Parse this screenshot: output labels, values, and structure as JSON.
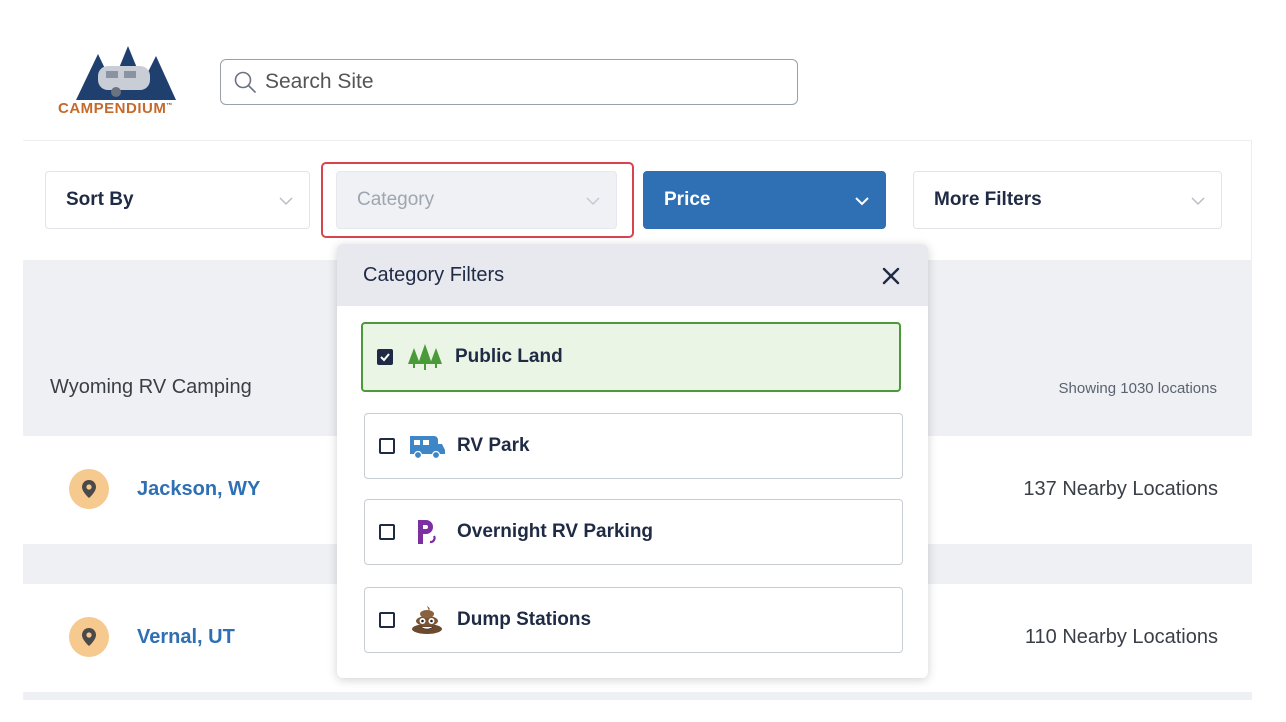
{
  "brand": {
    "logo_text": "CAMPENDIUM",
    "tm": "™"
  },
  "search": {
    "placeholder": "Search Site"
  },
  "filters": {
    "sort_label": "Sort By",
    "category_label": "Category",
    "price_label": "Price",
    "more_label": "More Filters"
  },
  "category_panel": {
    "title": "Category Filters",
    "options": [
      {
        "label": "Public Land",
        "checked": true,
        "icon": "trees-icon"
      },
      {
        "label": "RV Park",
        "checked": false,
        "icon": "rv-icon"
      },
      {
        "label": "Overnight RV Parking",
        "checked": false,
        "icon": "overnight-parking-icon"
      },
      {
        "label": "Dump Stations",
        "checked": false,
        "icon": "dump-station-icon"
      }
    ]
  },
  "listing": {
    "region_title": "Wyoming RV Camping",
    "showing": "Showing 1030 locations",
    "rows": [
      {
        "city": "Jackson, WY",
        "nearby": "137 Nearby Locations"
      },
      {
        "city": "Vernal, UT",
        "nearby": "110 Nearby Locations"
      }
    ]
  },
  "colors": {
    "brand_orange": "#c46a2c",
    "brand_navy": "#1f3f6e",
    "price_blue": "#2f6fb3",
    "highlight_red": "#d9434e",
    "selected_green": "#4a9a3a",
    "pin_bg": "#f6c98e"
  }
}
